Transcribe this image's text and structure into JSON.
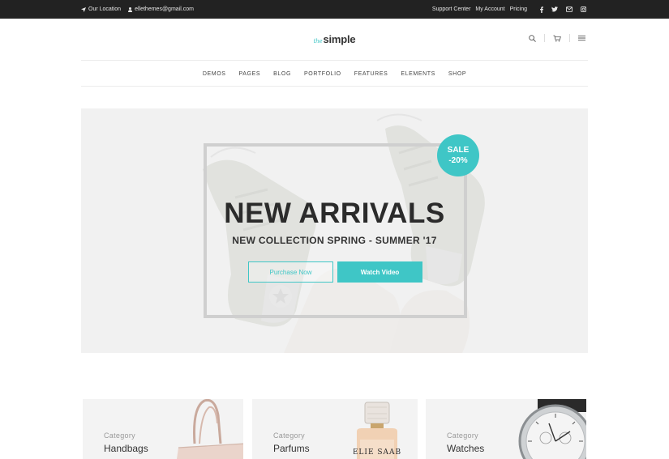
{
  "topbar": {
    "location_label": "Our Location",
    "email_label": "ellethemes@gmail.com",
    "links": [
      "Support Center",
      "My Account",
      "Pricing"
    ],
    "social_icons": [
      "facebook-icon",
      "twitter-icon",
      "mail-icon",
      "instagram-icon"
    ]
  },
  "header": {
    "logo_prefix": "the",
    "logo_main": "simple",
    "icons": [
      "search-icon",
      "cart-icon",
      "menu-icon"
    ]
  },
  "nav": {
    "items": [
      "DEMOS",
      "PAGES",
      "BLOG",
      "PORTFOLIO",
      "FEATURES",
      "ELEMENTS",
      "SHOP"
    ]
  },
  "hero": {
    "title": "NEW ARRIVALS",
    "subtitle": "NEW COLLECTION SPRING - SUMMER '17",
    "primary_button": "Purchase Now",
    "secondary_button": "Watch Video",
    "badge_line1": "SALE",
    "badge_line2": "-20%"
  },
  "categories": [
    {
      "label": "Category",
      "name": "Handbags"
    },
    {
      "label": "Category",
      "name": "Parfums",
      "product_text": "ELIE SAAB"
    },
    {
      "label": "Category",
      "name": "Watches"
    }
  ],
  "colors": {
    "accent": "#3fc6c6",
    "topbar_bg": "#222222",
    "hero_bg": "#eeeeee",
    "card_bg": "#f3f3f3"
  }
}
